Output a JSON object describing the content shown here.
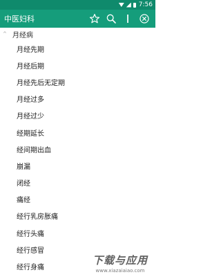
{
  "status_bar": {
    "time": "7:56"
  },
  "app_bar": {
    "title": "中医妇科",
    "actions": [
      "star-icon",
      "search-icon",
      "divider-icon",
      "close-circle-icon"
    ]
  },
  "colors": {
    "status_bar": "#0f8a6c",
    "app_bar": "#159d7b",
    "text": "#222222"
  },
  "group": {
    "label": "月经病",
    "expanded": true
  },
  "items": [
    "月经先期",
    "月经后期",
    "月经先后无定期",
    "月经过多",
    "月经过少",
    "经期延长",
    "经间期出血",
    "崩漏",
    "闭经",
    "痛经",
    "经行乳房胀痛",
    "经行头痛",
    "经行感冒",
    "经行身痛"
  ],
  "watermark": {
    "main": "下载与应用",
    "sub": "www.xiazaiaiao.com"
  }
}
